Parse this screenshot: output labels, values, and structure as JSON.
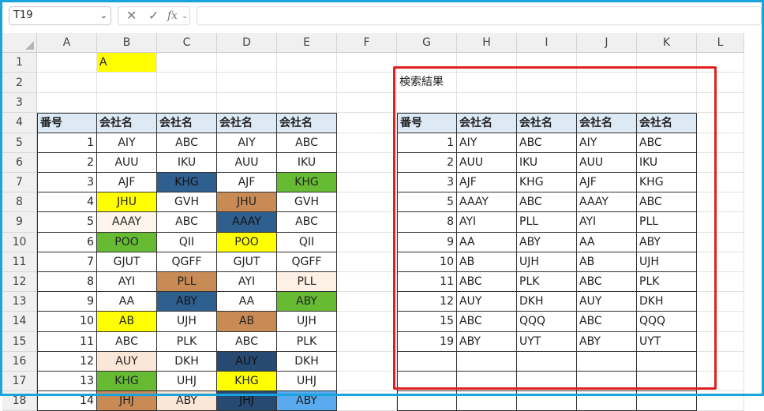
{
  "name_box": "T19",
  "formula_bar": {
    "fx_label": "fx",
    "value": ""
  },
  "column_letters": [
    "A",
    "B",
    "C",
    "D",
    "E",
    "F",
    "G",
    "H",
    "I",
    "J",
    "K",
    "L"
  ],
  "row_numbers": [
    "1",
    "2",
    "3",
    "4",
    "5",
    "6",
    "7",
    "8",
    "9",
    "10",
    "11",
    "12",
    "13",
    "14",
    "15",
    "16",
    "17",
    "18"
  ],
  "sheet": {
    "b1": "A",
    "g2": "検索結果",
    "header_number": "番号",
    "header_company": "会社名",
    "left_rows": [
      [
        "1",
        "AIY",
        "ABC",
        "AIY",
        "ABC"
      ],
      [
        "2",
        "AUU",
        "IKU",
        "AUU",
        "IKU"
      ],
      [
        "3",
        "AJF",
        "KHG",
        "AJF",
        "KHG"
      ],
      [
        "4",
        "JHU",
        "GVH",
        "JHU",
        "GVH"
      ],
      [
        "5",
        "AAAY",
        "ABC",
        "AAAY",
        "ABC"
      ],
      [
        "6",
        "POO",
        "QII",
        "POO",
        "QII"
      ],
      [
        "7",
        "GJUT",
        "QGFF",
        "GJUT",
        "QGFF"
      ],
      [
        "8",
        "AYI",
        "PLL",
        "AYI",
        "PLL"
      ],
      [
        "9",
        "AA",
        "ABY",
        "AA",
        "ABY"
      ],
      [
        "10",
        "AB",
        "UJH",
        "AB",
        "UJH"
      ],
      [
        "11",
        "ABC",
        "PLK",
        "ABC",
        "PLK"
      ],
      [
        "12",
        "AUY",
        "DKH",
        "AUY",
        "DKH"
      ],
      [
        "13",
        "KHG",
        "UHJ",
        "KHG",
        "UHJ"
      ],
      [
        "14",
        "JHJ",
        "ABY",
        "JHJ",
        "ABY"
      ]
    ],
    "right_rows": [
      [
        "1",
        "AIY",
        "ABC",
        "AIY",
        "ABC"
      ],
      [
        "2",
        "AUU",
        "IKU",
        "AUU",
        "IKU"
      ],
      [
        "3",
        "AJF",
        "KHG",
        "AJF",
        "KHG"
      ],
      [
        "5",
        "AAAY",
        "ABC",
        "AAAY",
        "ABC"
      ],
      [
        "8",
        "AYI",
        "PLL",
        "AYI",
        "PLL"
      ],
      [
        "9",
        "AA",
        "ABY",
        "AA",
        "ABY"
      ],
      [
        "10",
        "AB",
        "UJH",
        "AB",
        "UJH"
      ],
      [
        "11",
        "ABC",
        "PLK",
        "ABC",
        "PLK"
      ],
      [
        "12",
        "AUY",
        "DKH",
        "AUY",
        "DKH"
      ],
      [
        "15",
        "ABC",
        "QQQ",
        "ABC",
        "QQQ"
      ],
      [
        "19",
        "ABY",
        "UYT",
        "ABY",
        "UYT"
      ],
      [
        "",
        "",
        "",
        "",
        ""
      ],
      [
        "",
        "",
        "",
        "",
        ""
      ],
      [
        "",
        "",
        "",
        "",
        ""
      ]
    ],
    "left_fills": [
      [
        "#ffffff",
        "#ffffff",
        "#ffffff",
        "#ffffff"
      ],
      [
        "#ffffff",
        "#ffffff",
        "#ffffff",
        "#ffffff"
      ],
      [
        "#ffffff",
        "#2f5f8f",
        "#ffffff",
        "#66bb33"
      ],
      [
        "#ffff00",
        "#ffffff",
        "#c98b55",
        "#ffffff"
      ],
      [
        "#fdf4ec",
        "#ffffff",
        "#2f5f8f",
        "#ffffff"
      ],
      [
        "#66bb33",
        "#ffffff",
        "#ffff00",
        "#ffffff"
      ],
      [
        "#ffffff",
        "#ffffff",
        "#ffffff",
        "#ffffff"
      ],
      [
        "#ffffff",
        "#c98b55",
        "#ffffff",
        "#fdf0e4"
      ],
      [
        "#ffffff",
        "#2f5f8f",
        "#ffffff",
        "#66bb33"
      ],
      [
        "#ffff00",
        "#ffffff",
        "#c98b55",
        "#ffffff"
      ],
      [
        "#ffffff",
        "#ffffff",
        "#ffffff",
        "#ffffff"
      ],
      [
        "#fbe7d8",
        "#ffffff",
        "#264a72",
        "#ffffff"
      ],
      [
        "#66bb33",
        "#ffffff",
        "#ffff00",
        "#ffffff"
      ],
      [
        "#c98b55",
        "#fbe7d8",
        "#264a72",
        "#5aaaf0"
      ]
    ],
    "b1_fill": "#ffff00"
  },
  "colors": {
    "frame": "#1aa3dc",
    "highlight": "#e02020",
    "header_fill": "#dde9f5"
  }
}
